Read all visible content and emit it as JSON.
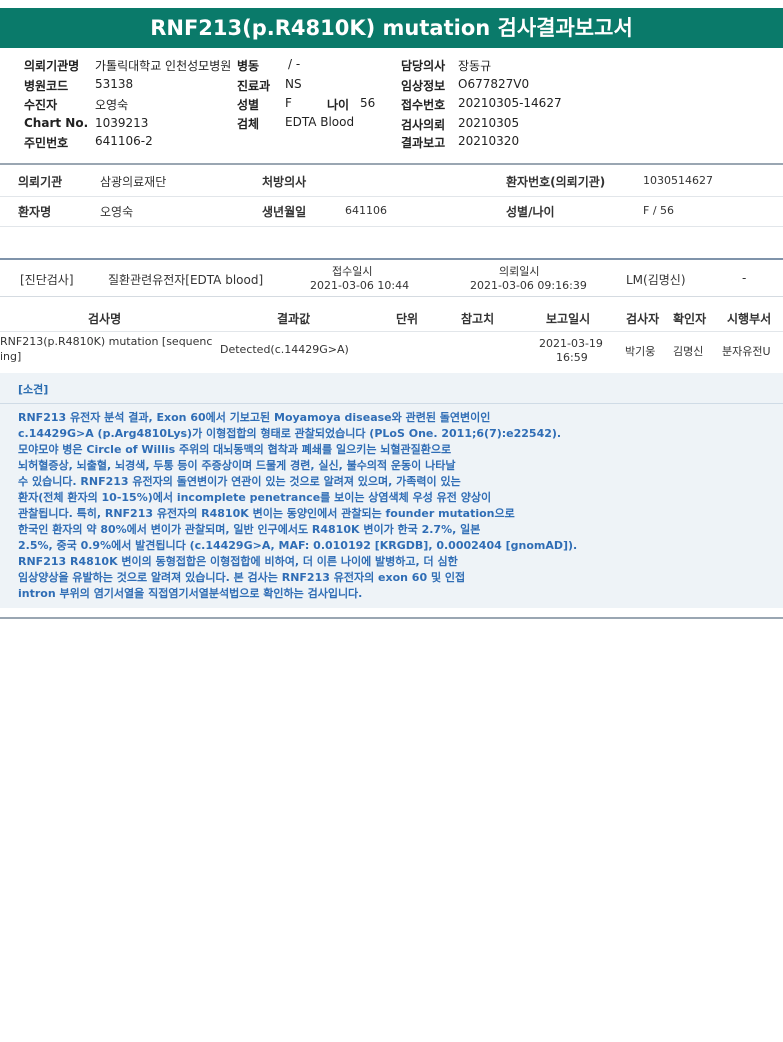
{
  "title": "RNF213(p.R4810K) mutation 검사결과보고서",
  "header": {
    "left": [
      {
        "label": "의뢰기관명",
        "value": "가톨릭대학교 인천성모병원"
      },
      {
        "label": "병원코드",
        "value": "53138"
      },
      {
        "label": "수진자",
        "value": "오영숙"
      },
      {
        "label": "Chart No.",
        "value": "1039213"
      },
      {
        "label": "주민번호",
        "value": "641106-2"
      }
    ],
    "mid": [
      {
        "label": "병동",
        "value": "/ -"
      },
      {
        "label": "진료과",
        "value": "NS"
      },
      {
        "label": "성별",
        "value": "F"
      },
      {
        "label": "검체",
        "value": "EDTA Blood"
      }
    ],
    "age": {
      "label": "나이",
      "value": "56"
    },
    "right": [
      {
        "label": "담당의사",
        "value": "장동규"
      },
      {
        "label": "임상정보",
        "value": "O677827V0"
      },
      {
        "label": "접수번호",
        "value": "20210305-14627"
      },
      {
        "label": "검사의뢰",
        "value": "20210305"
      },
      {
        "label": "결과보고",
        "value": "20210320"
      }
    ]
  },
  "info": {
    "org_label": "의뢰기관",
    "org_value": "삼광의료재단",
    "doctor_label": "처방의사",
    "doctor_value": "",
    "patno_label": "환자번호(의뢰기관)",
    "patno_value": "1030514627",
    "name_label": "환자명",
    "name_value": "오영숙",
    "birth_label": "생년월일",
    "birth_value": "641106",
    "sexage_label": "성별/나이",
    "sexage_value": "F / 56"
  },
  "order": {
    "category": "[진단검사]",
    "specimen": "질환관련유전자[EDTA blood]",
    "received_label": "접수일시",
    "received_value": "2021-03-06 10:44",
    "requested_label": "의뢰일시",
    "requested_value": "2021-03-06 09:16:39",
    "lm": "LM(김명신)",
    "dash": "-"
  },
  "table": {
    "headers": [
      "검사명",
      "결과값",
      "단위",
      "참고치",
      "보고일시",
      "검사자",
      "확인자",
      "시행부서"
    ],
    "row": {
      "name_line1": "RNF213(p.R4810K) mutation [sequenc",
      "name_line2": "ing]",
      "result": "Detected(c.14429G>A)",
      "unit": "",
      "ref": "",
      "report_date": "2021-03-19",
      "report_time": "16:59",
      "tester": "박기웅",
      "confirmer": "김명신",
      "dept": "분자유전U"
    }
  },
  "findings": {
    "title": "[소견]",
    "lines": [
      "RNF213 유전자 분석 결과, Exon 60에서 기보고된 Moyamoya disease와 관련된 돌연변이인",
      "c.14429G>A (p.Arg4810Lys)가 이형접합의 형태로 관찰되었습니다 (PLoS One. 2011;6(7):e22542).",
      "모야모야 병은 Circle of Willis 주위의 대뇌동맥의 협착과 폐쇄를 일으키는 뇌혈관질환으로",
      "뇌허혈증상, 뇌출혈, 뇌경색, 두통 등이 주증상이며 드물게 경련, 실신, 불수의적 운동이 나타날",
      "수 있습니다. RNF213 유전자의 돌연변이가 연관이 있는 것으로 알려져 있으며, 가족력이 있는",
      "환자(전체 환자의 10-15%)에서 incomplete penetrance를 보이는 상염색체 우성 유전 양상이",
      "관찰됩니다. 특히, RNF213 유전자의 R4810K 변이는 동양인에서 관찰되는 founder mutation으로",
      "한국인 환자의 약 80%에서 변이가 관찰되며, 일반 인구에서도 R4810K 변이가 한국 2.7%, 일본",
      "2.5%, 중국 0.9%에서 발견됩니다 (c.14429G>A, MAF: 0.010192 [KRGDB], 0.0002404 [gnomAD]).",
      "RNF213 R4810K 변이의 동형접합은 이형접합에 비하여, 더 이른 나이에 발병하고, 더 심한",
      "임상양상을 유발하는 것으로 알려져 있습니다. 본 검사는 RNF213 유전자의 exon 60 및 인접",
      "intron 부위의 염기서열을 직접염기서열분석법으로 확인하는 검사입니다."
    ]
  },
  "colors": {
    "title_bg": "#0a7a6a",
    "findings_text": "#2f6db5",
    "findings_bg": "#eef3f7"
  }
}
